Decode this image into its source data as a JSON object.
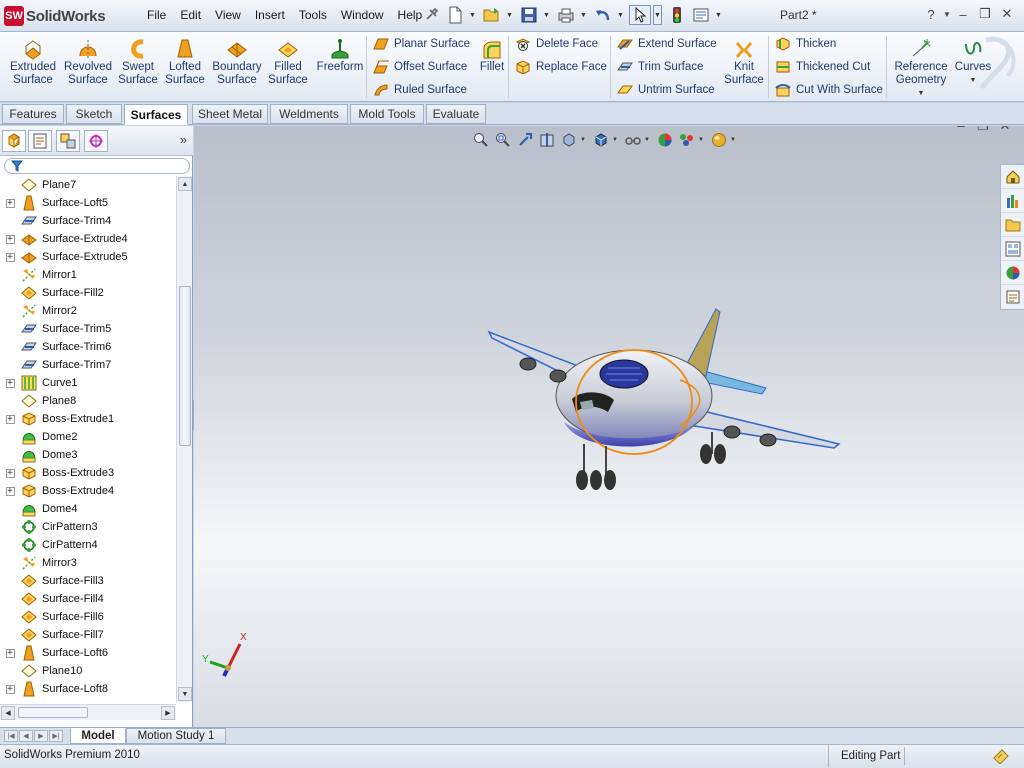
{
  "app": {
    "logo_mark": "SW",
    "brand": "SolidWorks",
    "document_title": "Part2 *"
  },
  "menu": [
    "File",
    "Edit",
    "View",
    "Insert",
    "Tools",
    "Window",
    "Help"
  ],
  "quick_access": {
    "icons": [
      "pin-icon",
      "new-document-icon",
      "open-folder-icon",
      "save-icon",
      "print-icon",
      "undo-icon",
      "select-arrow-icon",
      "rebuild-traffic-light-icon",
      "options-icon"
    ]
  },
  "window_controls": {
    "help": "?",
    "minimize": "–",
    "restore": "❐",
    "close": "✕"
  },
  "ribbon": {
    "big_buttons": [
      {
        "id": "extruded-surface",
        "label": "Extruded Surface",
        "icon": "extruded-surface-icon"
      },
      {
        "id": "revolved-surface",
        "label": "Revolved Surface",
        "icon": "revolved-surface-icon"
      },
      {
        "id": "swept-surface",
        "label": "Swept Surface",
        "icon": "swept-surface-icon"
      },
      {
        "id": "lofted-surface",
        "label": "Lofted Surface",
        "icon": "lofted-surface-icon"
      },
      {
        "id": "boundary-surface",
        "label": "Boundary Surface",
        "icon": "boundary-surface-icon"
      },
      {
        "id": "filled-surface",
        "label": "Filled Surface",
        "icon": "filled-surface-icon"
      },
      {
        "id": "freeform",
        "label": "Freeform",
        "icon": "freeform-icon"
      }
    ],
    "group_planar": [
      "Planar Surface",
      "Offset Surface",
      "Ruled Surface"
    ],
    "fillet": "Fillet",
    "group_face": [
      "Delete Face",
      "Replace Face"
    ],
    "group_extend": [
      "Extend Surface",
      "Trim Surface",
      "Untrim Surface"
    ],
    "knit_surface": "Knit Surface",
    "group_thicken": [
      "Thicken",
      "Thickened Cut",
      "Cut With Surface"
    ],
    "reference_geometry": "Reference Geometry",
    "curves": "Curves"
  },
  "command_tabs": [
    {
      "label": "Features",
      "active": false
    },
    {
      "label": "Sketch",
      "active": false
    },
    {
      "label": "Surfaces",
      "active": true
    },
    {
      "label": "Sheet Metal",
      "active": false
    },
    {
      "label": "Weldments",
      "active": false
    },
    {
      "label": "Mold Tools",
      "active": false
    },
    {
      "label": "Evaluate",
      "active": false
    }
  ],
  "feature_tree": [
    {
      "label": "Plane7",
      "type": "plane",
      "expandable": false
    },
    {
      "label": "Surface-Loft5",
      "type": "loft",
      "expandable": true
    },
    {
      "label": "Surface-Trim4",
      "type": "trim",
      "expandable": false
    },
    {
      "label": "Surface-Extrude4",
      "type": "extrude-surface",
      "expandable": true
    },
    {
      "label": "Surface-Extrude5",
      "type": "extrude-surface",
      "expandable": true
    },
    {
      "label": "Mirror1",
      "type": "mirror",
      "expandable": false
    },
    {
      "label": "Surface-Fill2",
      "type": "fill",
      "expandable": false
    },
    {
      "label": "Mirror2",
      "type": "mirror",
      "expandable": false
    },
    {
      "label": "Surface-Trim5",
      "type": "trim",
      "expandable": false
    },
    {
      "label": "Surface-Trim6",
      "type": "trim",
      "expandable": false
    },
    {
      "label": "Surface-Trim7",
      "type": "trim",
      "expandable": false
    },
    {
      "label": "Curve1",
      "type": "curve",
      "expandable": true
    },
    {
      "label": "Plane8",
      "type": "plane",
      "expandable": false
    },
    {
      "label": "Boss-Extrude1",
      "type": "boss",
      "expandable": true
    },
    {
      "label": "Dome2",
      "type": "dome",
      "expandable": false
    },
    {
      "label": "Dome3",
      "type": "dome",
      "expandable": false
    },
    {
      "label": "Boss-Extrude3",
      "type": "boss",
      "expandable": true
    },
    {
      "label": "Boss-Extrude4",
      "type": "boss",
      "expandable": true
    },
    {
      "label": "Dome4",
      "type": "dome",
      "expandable": false
    },
    {
      "label": "CirPattern3",
      "type": "pattern",
      "expandable": false
    },
    {
      "label": "CirPattern4",
      "type": "pattern",
      "expandable": false
    },
    {
      "label": "Mirror3",
      "type": "mirror",
      "expandable": false
    },
    {
      "label": "Surface-Fill3",
      "type": "fill",
      "expandable": false
    },
    {
      "label": "Surface-Fill4",
      "type": "fill",
      "expandable": false
    },
    {
      "label": "Surface-Fill6",
      "type": "fill",
      "expandable": false
    },
    {
      "label": "Surface-Fill7",
      "type": "fill",
      "expandable": false
    },
    {
      "label": "Surface-Loft6",
      "type": "loft",
      "expandable": true
    },
    {
      "label": "Plane10",
      "type": "plane",
      "expandable": false
    },
    {
      "label": "Surface-Loft8",
      "type": "loft",
      "expandable": true
    }
  ],
  "triad": {
    "x": "X",
    "y": "Y"
  },
  "bottom_tabs": [
    {
      "label": "Model",
      "active": true
    },
    {
      "label": "Motion Study 1",
      "active": false
    }
  ],
  "status": {
    "product": "SolidWorks Premium 2010",
    "mode": "Editing Part"
  },
  "colors": {
    "brand_red": "#c8102e",
    "ribbon_text": "#1e3a6e",
    "selection": "#316ac5",
    "icon_orange": "#f0a020"
  }
}
